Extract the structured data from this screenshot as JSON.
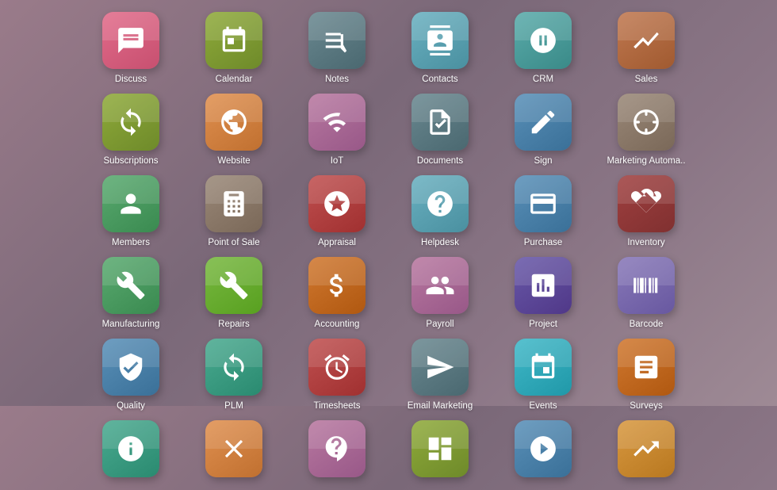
{
  "apps": [
    {
      "id": "discuss",
      "label": "Discuss",
      "color": "c-pink",
      "icon": "discuss"
    },
    {
      "id": "calendar",
      "label": "Calendar",
      "color": "c-olive",
      "icon": "calendar"
    },
    {
      "id": "notes",
      "label": "Notes",
      "color": "c-slate",
      "icon": "notes"
    },
    {
      "id": "contacts",
      "label": "Contacts",
      "color": "c-blue",
      "icon": "contacts"
    },
    {
      "id": "crm",
      "label": "CRM",
      "color": "c-teal",
      "icon": "crm"
    },
    {
      "id": "sales",
      "label": "Sales",
      "color": "c-brown",
      "icon": "sales"
    },
    {
      "id": "subscriptions",
      "label": "Subscriptions",
      "color": "c-olive",
      "icon": "subscriptions"
    },
    {
      "id": "website",
      "label": "Website",
      "color": "c-orange",
      "icon": "website"
    },
    {
      "id": "iot",
      "label": "IoT",
      "color": "c-mauve",
      "icon": "iot"
    },
    {
      "id": "documents",
      "label": "Documents",
      "color": "c-slate",
      "icon": "documents"
    },
    {
      "id": "sign",
      "label": "Sign",
      "color": "c-steelblue",
      "icon": "sign"
    },
    {
      "id": "marketing",
      "label": "Marketing Automa..",
      "color": "c-warmgray",
      "icon": "marketing"
    },
    {
      "id": "members",
      "label": "Members",
      "color": "c-green",
      "icon": "members"
    },
    {
      "id": "pos",
      "label": "Point of Sale",
      "color": "c-warmgray",
      "icon": "pos"
    },
    {
      "id": "appraisal",
      "label": "Appraisal",
      "color": "c-red",
      "icon": "appraisal"
    },
    {
      "id": "helpdesk",
      "label": "Helpdesk",
      "color": "c-blue",
      "icon": "helpdesk"
    },
    {
      "id": "purchase",
      "label": "Purchase",
      "color": "c-steelblue",
      "icon": "purchase"
    },
    {
      "id": "inventory",
      "label": "Inventory",
      "color": "c-darkred",
      "icon": "inventory"
    },
    {
      "id": "manufacturing",
      "label": "Manufacturing",
      "color": "c-green",
      "icon": "manufacturing"
    },
    {
      "id": "repairs",
      "label": "Repairs",
      "color": "c-grassgreen",
      "icon": "repairs"
    },
    {
      "id": "accounting",
      "label": "Accounting",
      "color": "c-darkorange",
      "icon": "accounting"
    },
    {
      "id": "payroll",
      "label": "Payroll",
      "color": "c-mauve",
      "icon": "payroll"
    },
    {
      "id": "project",
      "label": "Project",
      "color": "c-darkpurple",
      "icon": "project"
    },
    {
      "id": "barcode",
      "label": "Barcode",
      "color": "c-purple",
      "icon": "barcode"
    },
    {
      "id": "quality",
      "label": "Quality",
      "color": "c-steelblue",
      "icon": "quality"
    },
    {
      "id": "plm",
      "label": "PLM",
      "color": "c-bluegreen",
      "icon": "plm"
    },
    {
      "id": "timesheets",
      "label": "Timesheets",
      "color": "c-red",
      "icon": "timesheets"
    },
    {
      "id": "emailmkt",
      "label": "Email Marketing",
      "color": "c-slate",
      "icon": "emailmkt"
    },
    {
      "id": "events",
      "label": "Events",
      "color": "c-cyan",
      "icon": "events"
    },
    {
      "id": "surveys",
      "label": "Surveys",
      "color": "c-darkorange",
      "icon": "surveys"
    },
    {
      "id": "app31",
      "label": "",
      "color": "c-bluegreen",
      "icon": "generic"
    },
    {
      "id": "app32",
      "label": "",
      "color": "c-orange",
      "icon": "generic2"
    },
    {
      "id": "app33",
      "label": "",
      "color": "c-mauve",
      "icon": "generic3"
    },
    {
      "id": "app34",
      "label": "",
      "color": "c-olive",
      "icon": "generic4"
    },
    {
      "id": "app35",
      "label": "",
      "color": "c-steelblue",
      "icon": "generic5"
    },
    {
      "id": "app36",
      "label": "",
      "color": "c-goldorange",
      "icon": "generic6"
    }
  ]
}
